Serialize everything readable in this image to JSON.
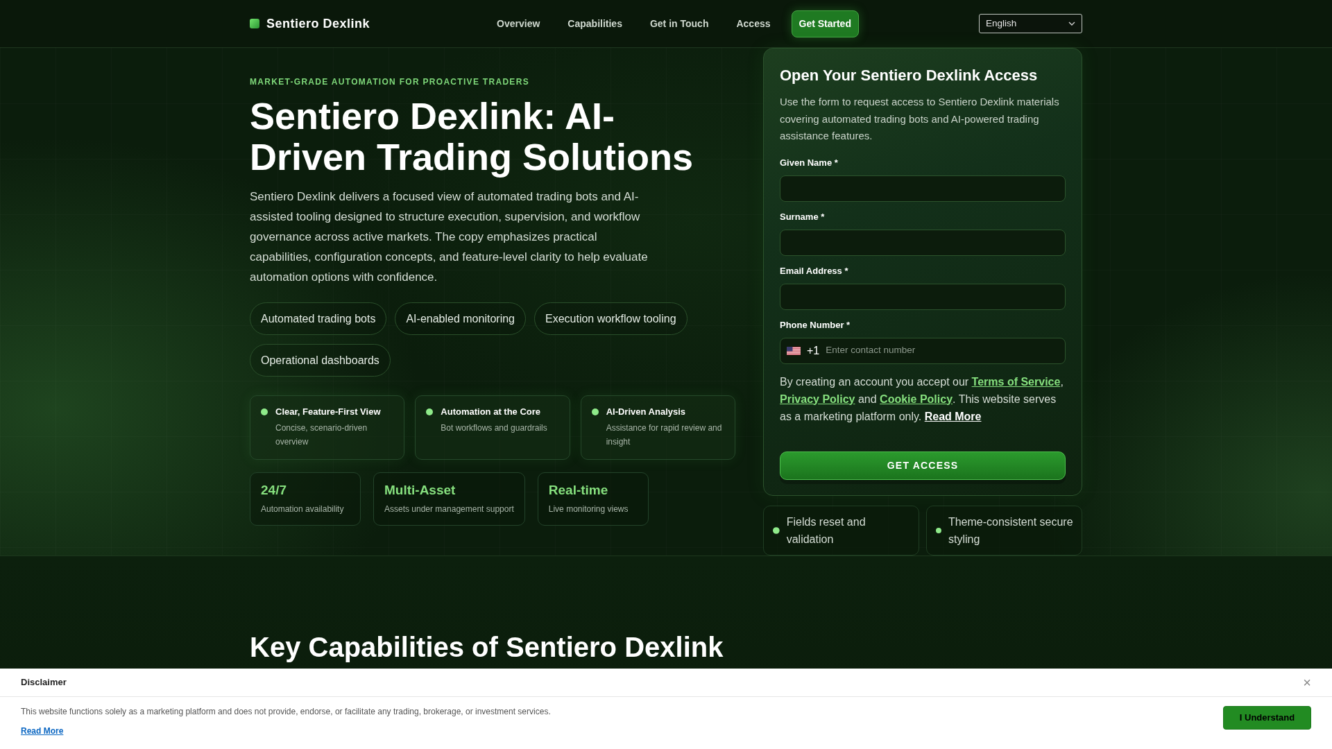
{
  "nav": {
    "brand": "Sentiero Dexlink",
    "links": [
      {
        "label": "Overview",
        "kind": "link"
      },
      {
        "label": "Capabilities",
        "kind": "link"
      },
      {
        "label": "Get in Touch",
        "kind": "link"
      },
      {
        "label": "Access",
        "kind": "link"
      },
      {
        "label": "Get Started",
        "kind": "button"
      }
    ],
    "language": {
      "value": "English"
    }
  },
  "hero": {
    "eyebrow": "MARKET-GRADE AUTOMATION FOR PROACTIVE TRADERS",
    "title": "Sentiero Dexlink: AI-Driven Trading Solutions",
    "description": "Sentiero Dexlink delivers a focused view of automated trading bots and AI-assisted tooling designed to structure execution, supervision, and workflow governance across active markets. The copy emphasizes practical capabilities, configuration concepts, and feature-level clarity to help evaluate automation options with confidence.",
    "tags": [
      "Automated trading bots",
      "AI-enabled monitoring",
      "Execution workflow tooling",
      "Operational dashboards"
    ],
    "features": [
      {
        "title": "Clear, Feature-First View",
        "text": "Concise, scenario-driven overview"
      },
      {
        "title": "Automation at the Core",
        "text": "Bot workflows and guardrails"
      },
      {
        "title": "AI-Driven Analysis",
        "text": "Assistance for rapid review and insight"
      }
    ],
    "stats": [
      {
        "value": "24/7",
        "label": "Automation availability"
      },
      {
        "value": "Multi-Asset",
        "label": "Assets under management support"
      },
      {
        "value": "Real-time",
        "label": "Live monitoring views"
      }
    ]
  },
  "form": {
    "title": "Open Your Sentiero Dexlink Access",
    "description": "Use the form to request access to Sentiero Dexlink materials covering automated trading bots and AI-powered trading assistance features.",
    "fields": [
      {
        "label": "Given Name *",
        "kind": "text"
      },
      {
        "label": "Surname *",
        "kind": "text"
      },
      {
        "label": "Email Address *",
        "kind": "email"
      },
      {
        "label": "Phone Number *",
        "kind": "phone",
        "country_code": "+1",
        "placeholder": "Enter contact number"
      }
    ],
    "consent": [
      {
        "kind": "text",
        "text": "By creating an account you accept our "
      },
      {
        "kind": "policy_link",
        "text": "Terms of Service"
      },
      {
        "kind": "text",
        "text": ", "
      },
      {
        "kind": "policy_link",
        "text": "Privacy Policy"
      },
      {
        "kind": "text",
        "text": " and "
      },
      {
        "kind": "policy_link",
        "text": "Cookie Policy"
      },
      {
        "kind": "text",
        "text": ". This website serves as a marketing platform only. "
      },
      {
        "kind": "more_link",
        "text": "Read More"
      }
    ],
    "submit": "GET ACCESS"
  },
  "form_notes": [
    "Fields reset and validation",
    "Theme-consistent secure styling"
  ],
  "capabilities": {
    "title": "Key Capabilities of Sentiero Dexlink"
  },
  "disclaimer": {
    "title": "Disclaimer",
    "close": "×",
    "text": "This website functions solely as a marketing platform and does not provide, endorse, or facilitate any trading, brokerage, or investment services.",
    "link": "Read More",
    "button": "I Understand"
  }
}
